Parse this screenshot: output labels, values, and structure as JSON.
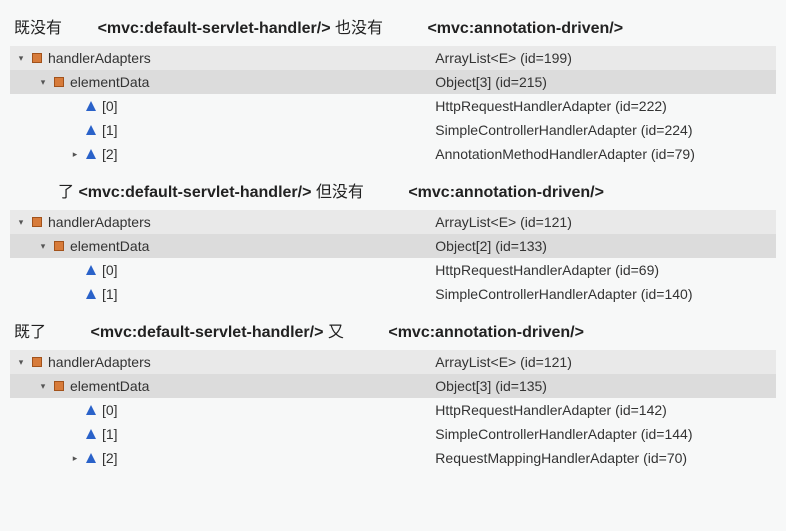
{
  "captions": {
    "c1_a": "既没有",
    "c1_tag1": "<mvc:default-servlet-handler/>",
    "c1_b": " 也没有",
    "c1_tag2": "<mvc:annotation-driven/>",
    "c2_a": "了 ",
    "c2_tag1": "<mvc:default-servlet-handler/>",
    "c2_b": " 但没有",
    "c2_tag2": "<mvc:annotation-driven/>",
    "c3_a": "既了",
    "c3_tag1": "<mvc:default-servlet-handler/>",
    "c3_b": " 又",
    "c3_tag2": "<mvc:annotation-driven/>"
  },
  "panels": [
    {
      "rows": [
        {
          "level": 0,
          "twisty": "down",
          "icon": "square",
          "label": "handlerAdapters",
          "value": "ArrayList<E>  (id=199)",
          "header": true
        },
        {
          "level": 1,
          "twisty": "down",
          "icon": "square",
          "label": "elementData",
          "value": "Object[3]  (id=215)",
          "header": "dark"
        },
        {
          "level": 2,
          "twisty": "none",
          "icon": "triangle",
          "label": "[0]",
          "value": "HttpRequestHandlerAdapter  (id=222)"
        },
        {
          "level": 2,
          "twisty": "none",
          "icon": "triangle",
          "label": "[1]",
          "value": "SimpleControllerHandlerAdapter  (id=224)"
        },
        {
          "level": 2,
          "twisty": "right",
          "icon": "triangle",
          "label": "[2]",
          "value": "AnnotationMethodHandlerAdapter  (id=79)"
        }
      ]
    },
    {
      "rows": [
        {
          "level": 0,
          "twisty": "down",
          "icon": "square",
          "label": "handlerAdapters",
          "value": "ArrayList<E>  (id=121)",
          "header": true
        },
        {
          "level": 1,
          "twisty": "down",
          "icon": "square",
          "label": "elementData",
          "value": "Object[2]  (id=133)",
          "header": "dark"
        },
        {
          "level": 2,
          "twisty": "none",
          "icon": "triangle",
          "label": "[0]",
          "value": "HttpRequestHandlerAdapter  (id=69)"
        },
        {
          "level": 2,
          "twisty": "none",
          "icon": "triangle",
          "label": "[1]",
          "value": "SimpleControllerHandlerAdapter  (id=140)"
        }
      ]
    },
    {
      "rows": [
        {
          "level": 0,
          "twisty": "down",
          "icon": "square",
          "label": "handlerAdapters",
          "value": "ArrayList<E>  (id=121)",
          "header": true
        },
        {
          "level": 1,
          "twisty": "down",
          "icon": "square",
          "label": "elementData",
          "value": "Object[3]  (id=135)",
          "header": "dark"
        },
        {
          "level": 2,
          "twisty": "none",
          "icon": "triangle",
          "label": "[0]",
          "value": "HttpRequestHandlerAdapter  (id=142)"
        },
        {
          "level": 2,
          "twisty": "none",
          "icon": "triangle",
          "label": "[1]",
          "value": "SimpleControllerHandlerAdapter  (id=144)"
        },
        {
          "level": 2,
          "twisty": "right",
          "icon": "triangle",
          "label": "[2]",
          "value": "RequestMappingHandlerAdapter  (id=70)"
        }
      ]
    }
  ]
}
